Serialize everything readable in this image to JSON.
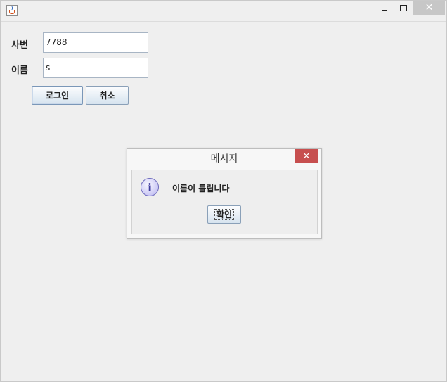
{
  "window": {
    "title": "",
    "close_symbol": "✕"
  },
  "form": {
    "employee_no_label": "사번",
    "employee_no_value": "7788",
    "name_label": "이름",
    "name_value": "s",
    "login_button": "로그인",
    "cancel_button": "취소"
  },
  "dialog": {
    "title": "메시지",
    "close_symbol": "✕",
    "icon": "info-icon",
    "icon_glyph": "i",
    "message": "이름이 틀립니다",
    "ok_button": "확인"
  }
}
